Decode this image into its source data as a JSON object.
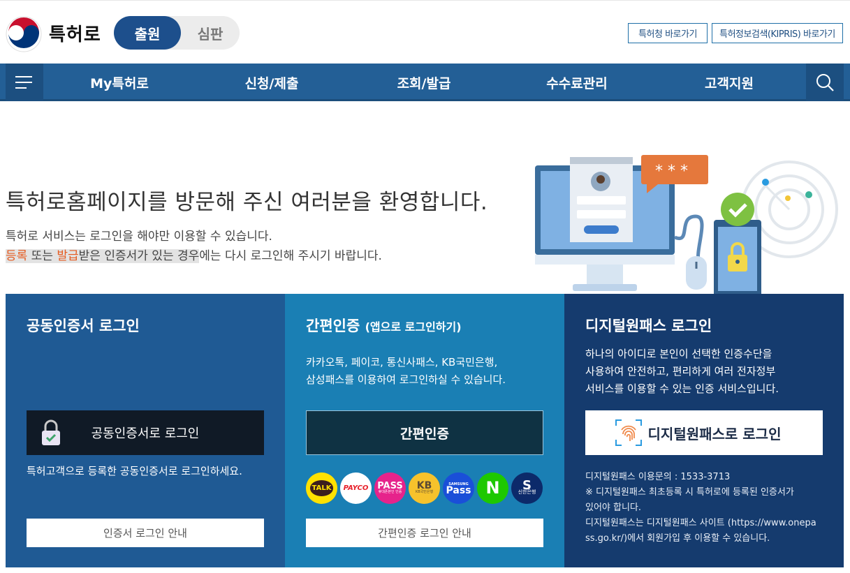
{
  "header": {
    "brand": "특허로",
    "toggle": {
      "active": "출원",
      "inactive": "심판"
    },
    "quick_links": [
      "특허청 바로가기",
      "특허정보검색(KIPRIS) 바로가기"
    ]
  },
  "nav": {
    "items": [
      "My특허로",
      "신청/제출",
      "조회/발급",
      "수수료관리",
      "고객지원"
    ],
    "menu_icon": "hamburger-icon",
    "search_icon": "search-icon"
  },
  "welcome": {
    "title": "특허로홈페이지를 방문해 주신 여러분을 환영합니다.",
    "line1": "특허로 서비스는 로그인을 해야만 이용할 수 있습니다.",
    "line2_a": "등록",
    "line2_b": " 또는 ",
    "line2_c": "발급",
    "line2_d": "받은 인증서가 있는 경우",
    "line2_e": "에는 다시 로그인해 주시기 바랍니다."
  },
  "panels": {
    "cert": {
      "title": "공동인증서 로그인",
      "button": "공동인증서로 로그인",
      "desc": "특허고객으로 등록한 공동인증서로 로그인하세요.",
      "guide": "인증서 로그인 안내"
    },
    "simple": {
      "title": "간편인증",
      "title_sub": "(앱으로 로그인하기)",
      "desc1": "카카오톡, 페이코, 통신사패스, KB국민은행,",
      "desc2": "삼성패스를 이용하여 로그인하실 수 있습니다.",
      "button": "간편인증",
      "apps": [
        "TALK",
        "PAYCO",
        "PASS",
        "KB",
        "Pass",
        "N",
        "S"
      ],
      "app_sub": {
        "pass": "휴대폰본인 인증",
        "kb": "KB국민은행",
        "samsung": "SAMSUNG",
        "shinhan": "신한은행"
      },
      "guide": "간편인증 로그인 안내"
    },
    "digital": {
      "title": "디지털원패스 로그인",
      "desc1": "하나의 아이디로 본인이 선택한 인증수단을",
      "desc2": "사용하여 안전하고, 편리하게 여러 전자정부",
      "desc3": "서비스를 이용할 수 있는 인증 서비스입니다.",
      "button": "디지털원패스로 로그인",
      "note1": "디지털원패스 이용문의 : 1533-3713",
      "note2": "※ 디지털원패스 최초등록 시 특허로에 등록된 인증서가",
      "note3": "있어야 합니다.",
      "note4": "디지털원패스는 디지털원패스 사이트 (https://www.onepa",
      "note5": "ss.go.kr/)에서 회원가입 후 이용할 수 있습니다."
    }
  },
  "colors": {
    "nav": "#235f96",
    "panel1": "#1f5a94",
    "panel2": "#1a7fb4",
    "panel3": "#153b6e",
    "accent": "#e65a1f"
  }
}
